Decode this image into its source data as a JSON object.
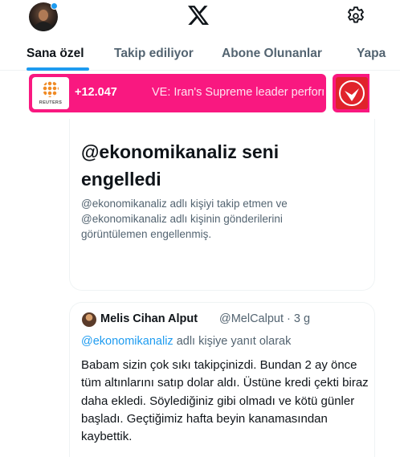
{
  "header": {
    "logo_icon": "x-logo-icon",
    "settings_icon": "gear-icon",
    "notification_dot_color": "#1d9bf0"
  },
  "tabs": [
    {
      "label": "Sana özel",
      "active": true
    },
    {
      "label": "Takip ediliyor",
      "active": false
    },
    {
      "label": "Abone Olunanlar",
      "active": false
    },
    {
      "label": "Yapa",
      "active": false
    }
  ],
  "ticker": {
    "source_logo_text": "REUTERS",
    "count": "+12.047",
    "headline": "VE: Iran's Supreme leader performs",
    "background_color": "#f91880"
  },
  "blocked_notice": {
    "title": "@ekonomikanaliz seni engelledi",
    "description": "@ekonomikanaliz adlı kişiyi takip etmen ve @ekonomikanaliz adlı kişinin gönderilerini görüntülemen engellenmiş."
  },
  "quoted_tweet": {
    "author_name": "Melis Cihan Alput",
    "handle_time": "@MelCalput · 3 g",
    "reply_mention": "@ekonomikanaliz",
    "reply_suffix": " adlı kişiye yanıt olarak",
    "body": "Babam sizin çok sıkı takipçinizdi. Bundan 2 ay önce tüm altınlarını satıp dolar aldı. Üstüne kredi çekti biraz daha ekledi. Söylediğiniz gibi olmadı ve kötü günler başladı. Geçtiğimiz hafta beyin kanamasından kaybettik."
  },
  "accent_color": "#1d9bf0"
}
